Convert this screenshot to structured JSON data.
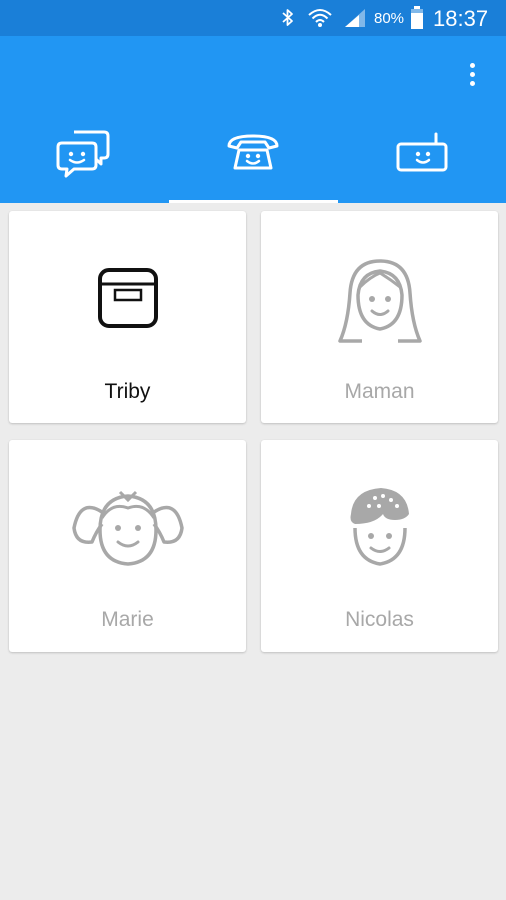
{
  "status_bar": {
    "battery_percent": "80%",
    "time": "18:37",
    "icons": [
      "bluetooth-icon",
      "wifi-icon",
      "signal-icon",
      "battery-icon"
    ]
  },
  "toolbar": {
    "menu_icon": "overflow-menu-icon"
  },
  "tabs": [
    {
      "icon": "chat-bubbles-icon",
      "selected": false
    },
    {
      "icon": "telephone-icon",
      "selected": true
    },
    {
      "icon": "radio-device-icon",
      "selected": false
    }
  ],
  "contacts": [
    {
      "name": "Triby",
      "icon": "triby-device-icon",
      "active": true
    },
    {
      "name": "Maman",
      "icon": "woman-avatar-icon",
      "active": false
    },
    {
      "name": "Marie",
      "icon": "girl-avatar-icon",
      "active": false
    },
    {
      "name": "Nicolas",
      "icon": "boy-avatar-icon",
      "active": false
    }
  ],
  "colors": {
    "status_bar": "#1a7fd8",
    "app_bar": "#2196f3",
    "background": "#ececec",
    "active_text": "#111111",
    "inactive_text": "#a8a8a8"
  }
}
